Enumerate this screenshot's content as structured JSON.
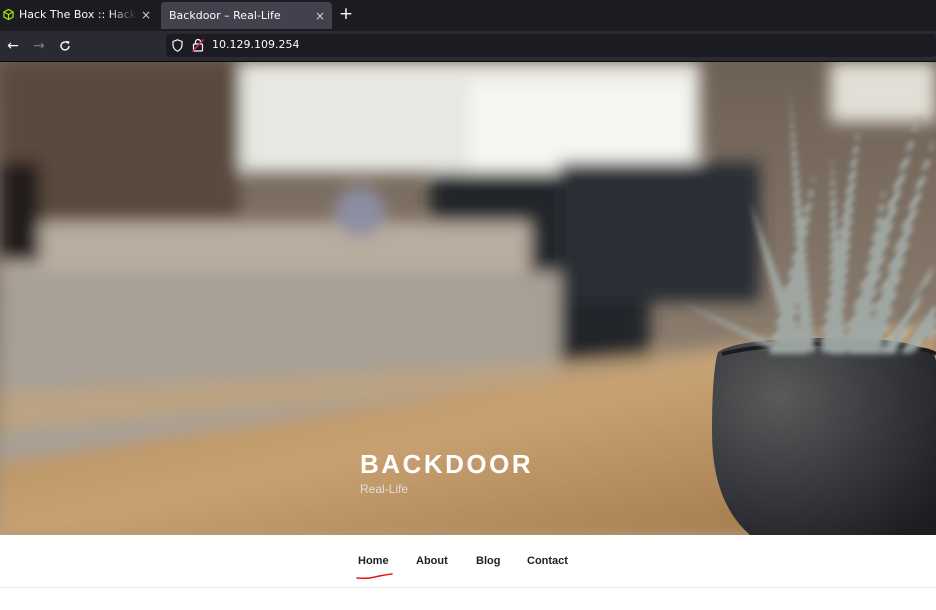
{
  "browser": {
    "tabs": [
      {
        "title": "Hack The Box :: Hack The",
        "close": "×",
        "favicon": "htb-cube-icon",
        "active": false
      },
      {
        "title": "Backdoor – Real-Life",
        "close": "×",
        "active": true
      }
    ],
    "new_tab": "+",
    "nav": {
      "back": "←",
      "forward": "→",
      "reload": "⟳"
    },
    "url": "10.129.109.254"
  },
  "site": {
    "title": "BACKDOOR",
    "description": "Real-Life"
  },
  "menu": {
    "items": [
      "Home",
      "About",
      "Blog",
      "Contact"
    ],
    "current": "Home",
    "annotation_color": "#e0201c"
  },
  "colors": {
    "tabbar_bg": "#1c1b22",
    "active_tab_bg": "#42414d",
    "htb_green": "#9fef00"
  }
}
